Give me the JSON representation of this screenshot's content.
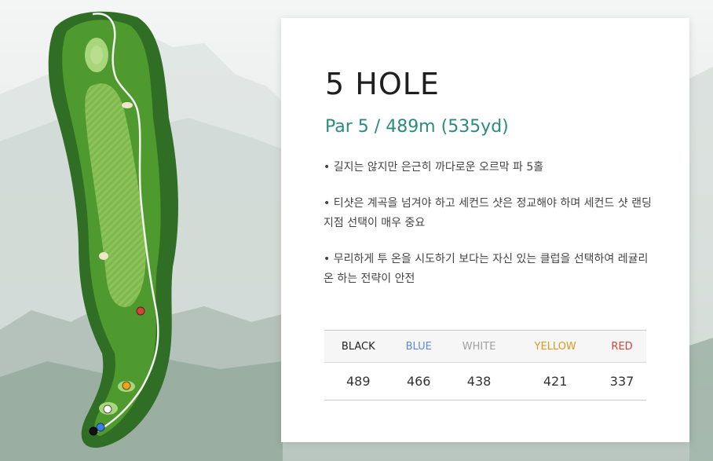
{
  "hole": {
    "title": "5 HOLE",
    "par_line": "Par 5 / 489m (535yd)",
    "description": [
      "• 길지는 않지만 은근히 까다로운 오르막 파 5홀",
      "• 티샷은 계곡을 넘겨야 하고 세컨드 샷은 정교해야 하며 세컨드 샷 랜딩지점 선택이 매우 중요",
      "• 무리하게 투 온을 시도하기 보다는 자신 있는 클럽을 선택하여 레귤리 온 하는 전략이 안전"
    ]
  },
  "tees": [
    {
      "name": "BLACK",
      "distance": "489",
      "color": "#222222"
    },
    {
      "name": "BLUE",
      "distance": "466",
      "color": "#5b8ad9"
    },
    {
      "name": "WHITE",
      "distance": "438",
      "color": "#a0a0a0"
    },
    {
      "name": "YELLOW",
      "distance": "421",
      "color": "#d99a1e"
    },
    {
      "name": "RED",
      "distance": "337",
      "color": "#d0443c"
    }
  ],
  "colors": {
    "accent": "#2a8c7c",
    "fairway": "#8cc45a",
    "rough": "#4f9a2e",
    "trees": "#2f6e24",
    "path": "#f2f2ee",
    "bunker": "#efe6c8"
  }
}
